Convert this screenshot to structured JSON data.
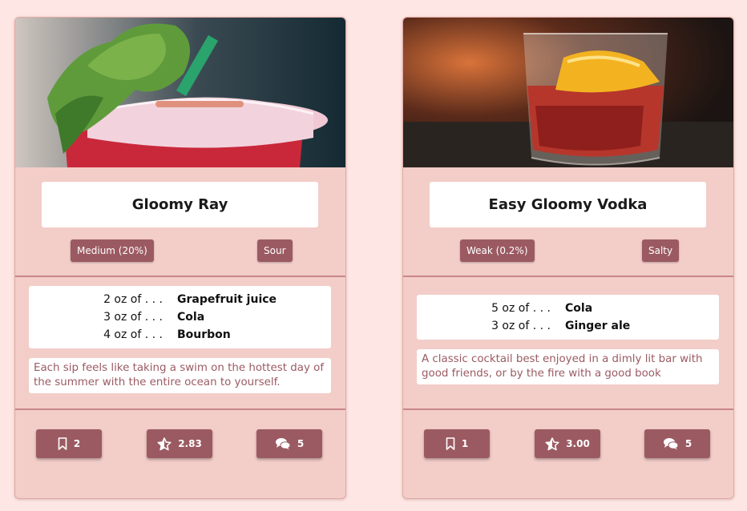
{
  "cards": [
    {
      "title": "Gloomy Ray",
      "strength": "Medium (20%)",
      "taste": "Sour",
      "ingredients": [
        {
          "amount": "2 oz of . . .",
          "name": "Grapefruit juice"
        },
        {
          "amount": "3 oz of . . .",
          "name": "Cola"
        },
        {
          "amount": "4 oz of . . .",
          "name": "Bourbon"
        }
      ],
      "description": "Each sip feels like taking a swim on the hottest day of the summer with the entire ocean to yourself.",
      "actions": {
        "bookmark_count": "2",
        "rating": "2.83",
        "comment_count": "5"
      }
    },
    {
      "title": "Easy Gloomy Vodka",
      "strength": "Weak (0.2%)",
      "taste": "Salty",
      "ingredients": [
        {
          "amount": "5 oz of . . .",
          "name": "Cola"
        },
        {
          "amount": "3 oz of . . .",
          "name": "Ginger ale"
        }
      ],
      "description": "A classic cocktail best enjoyed in a dimly lit bar with good friends, or by the fire with a good book",
      "actions": {
        "bookmark_count": "1",
        "rating": "3.00",
        "comment_count": "5"
      }
    }
  ],
  "icons": {
    "bookmark": "bookmark-icon",
    "rating": "star-half-icon",
    "comments": "comments-icon"
  },
  "colors": {
    "background": "#fde6e3",
    "card": "#f3cdc8",
    "accent": "#9b5a62",
    "divider": "#c9868a"
  }
}
